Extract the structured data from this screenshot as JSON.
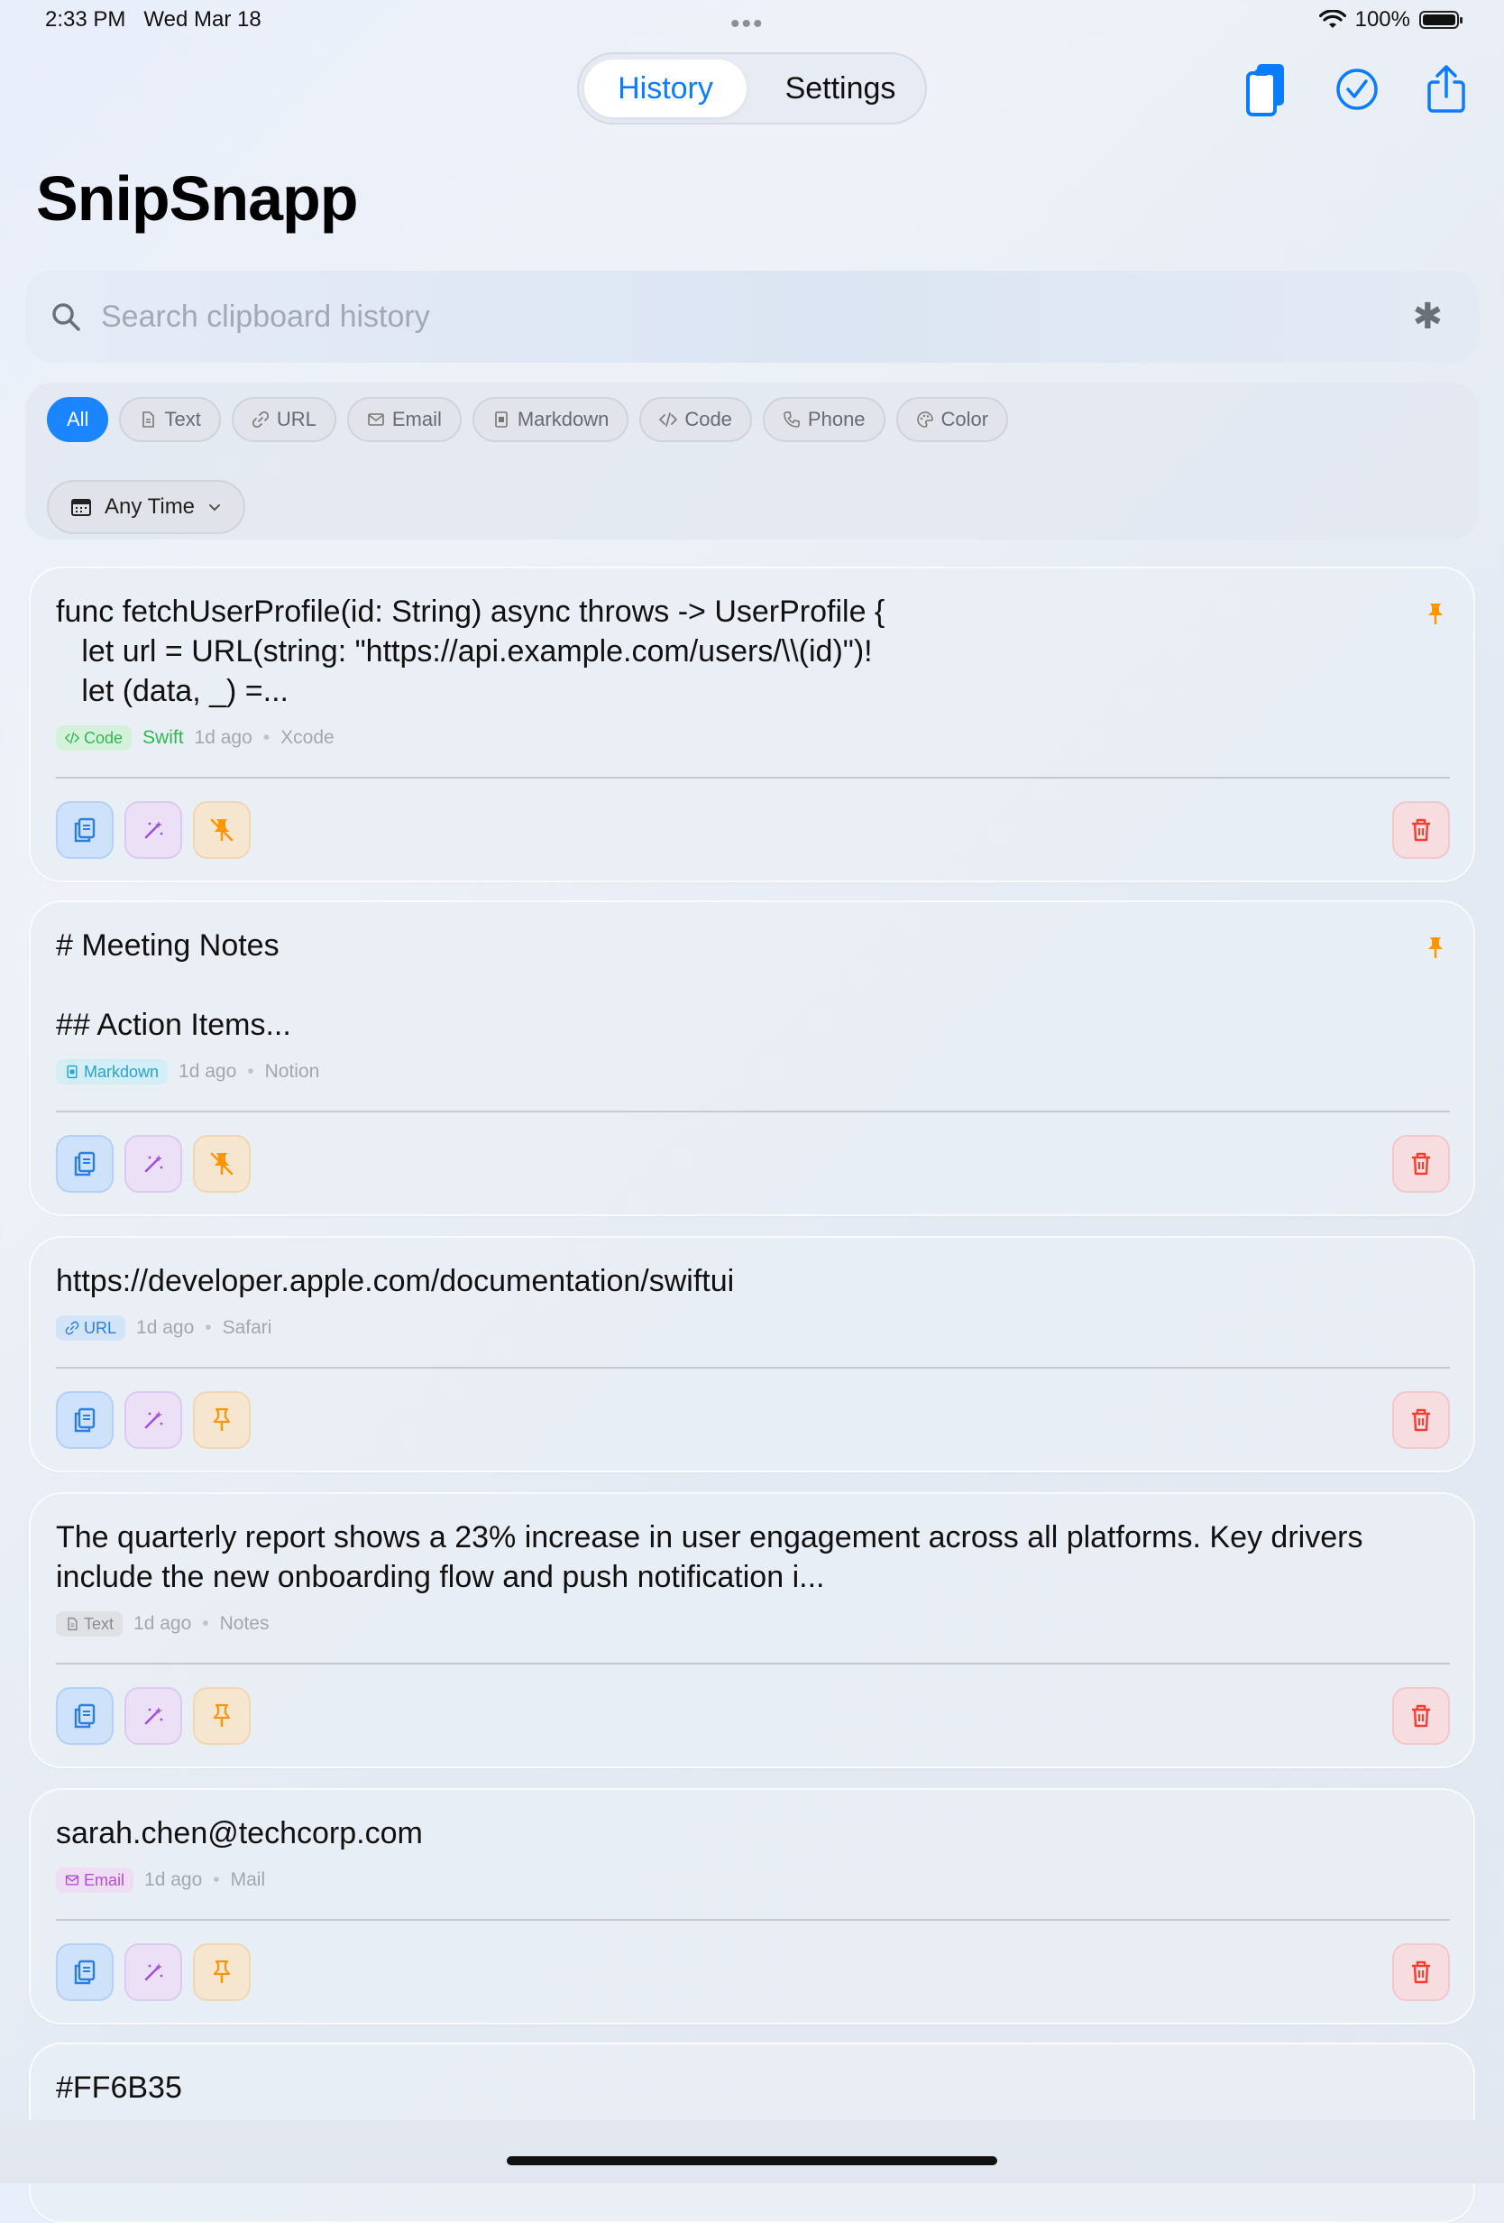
{
  "status_bar": {
    "time": "2:33 PM",
    "date": "Wed Mar 18",
    "battery": "100%"
  },
  "nav": {
    "tabs": [
      {
        "label": "History"
      },
      {
        "label": "Settings"
      }
    ]
  },
  "app_title": "SnipSnapp",
  "search": {
    "placeholder": "Search clipboard history"
  },
  "filters": {
    "chips": [
      {
        "label": "All",
        "icon": "none"
      },
      {
        "label": "Text",
        "icon": "document-icon"
      },
      {
        "label": "URL",
        "icon": "link-icon"
      },
      {
        "label": "Email",
        "icon": "envelope-icon"
      },
      {
        "label": "Markdown",
        "icon": "markdown-doc-icon"
      },
      {
        "label": "Code",
        "icon": "code-icon"
      },
      {
        "label": "Phone",
        "icon": "phone-icon"
      },
      {
        "label": "Color",
        "icon": "palette-icon"
      }
    ],
    "time_filter": "Any Time"
  },
  "colors": {
    "accent": "#1a85ff",
    "code_badge": "#30b850",
    "markdown_badge": "#2aa3c9",
    "url_badge": "#2a7fe0",
    "email_badge": "#b04fcf",
    "pin": "#ff9500",
    "delete": "#ff3b30"
  },
  "clips": [
    {
      "content": "func fetchUserProfile(id: String) async throws -> UserProfile {\n   let url = URL(string: \"https://api.example.com/users/\\\\(id)\")!\n   let (data, _) =...",
      "type_label": "Code",
      "language": "Swift",
      "time": "1d ago",
      "source": "Xcode",
      "pinned": true
    },
    {
      "content": "# Meeting Notes\n\n## Action Items...",
      "type_label": "Markdown",
      "time": "1d ago",
      "source": "Notion",
      "pinned": true
    },
    {
      "content": "https://developer.apple.com/documentation/swiftui",
      "type_label": "URL",
      "time": "1d ago",
      "source": "Safari",
      "pinned": false
    },
    {
      "content": "The quarterly report shows a 23% increase in user engagement across all platforms. Key drivers include the new onboarding flow and push notification i...",
      "type_label": "Text",
      "time": "1d ago",
      "source": "Notes",
      "pinned": false
    },
    {
      "content": "sarah.chen@techcorp.com",
      "type_label": "Email",
      "time": "1d ago",
      "source": "Mail",
      "pinned": false
    },
    {
      "content": "#FF6B35"
    }
  ]
}
